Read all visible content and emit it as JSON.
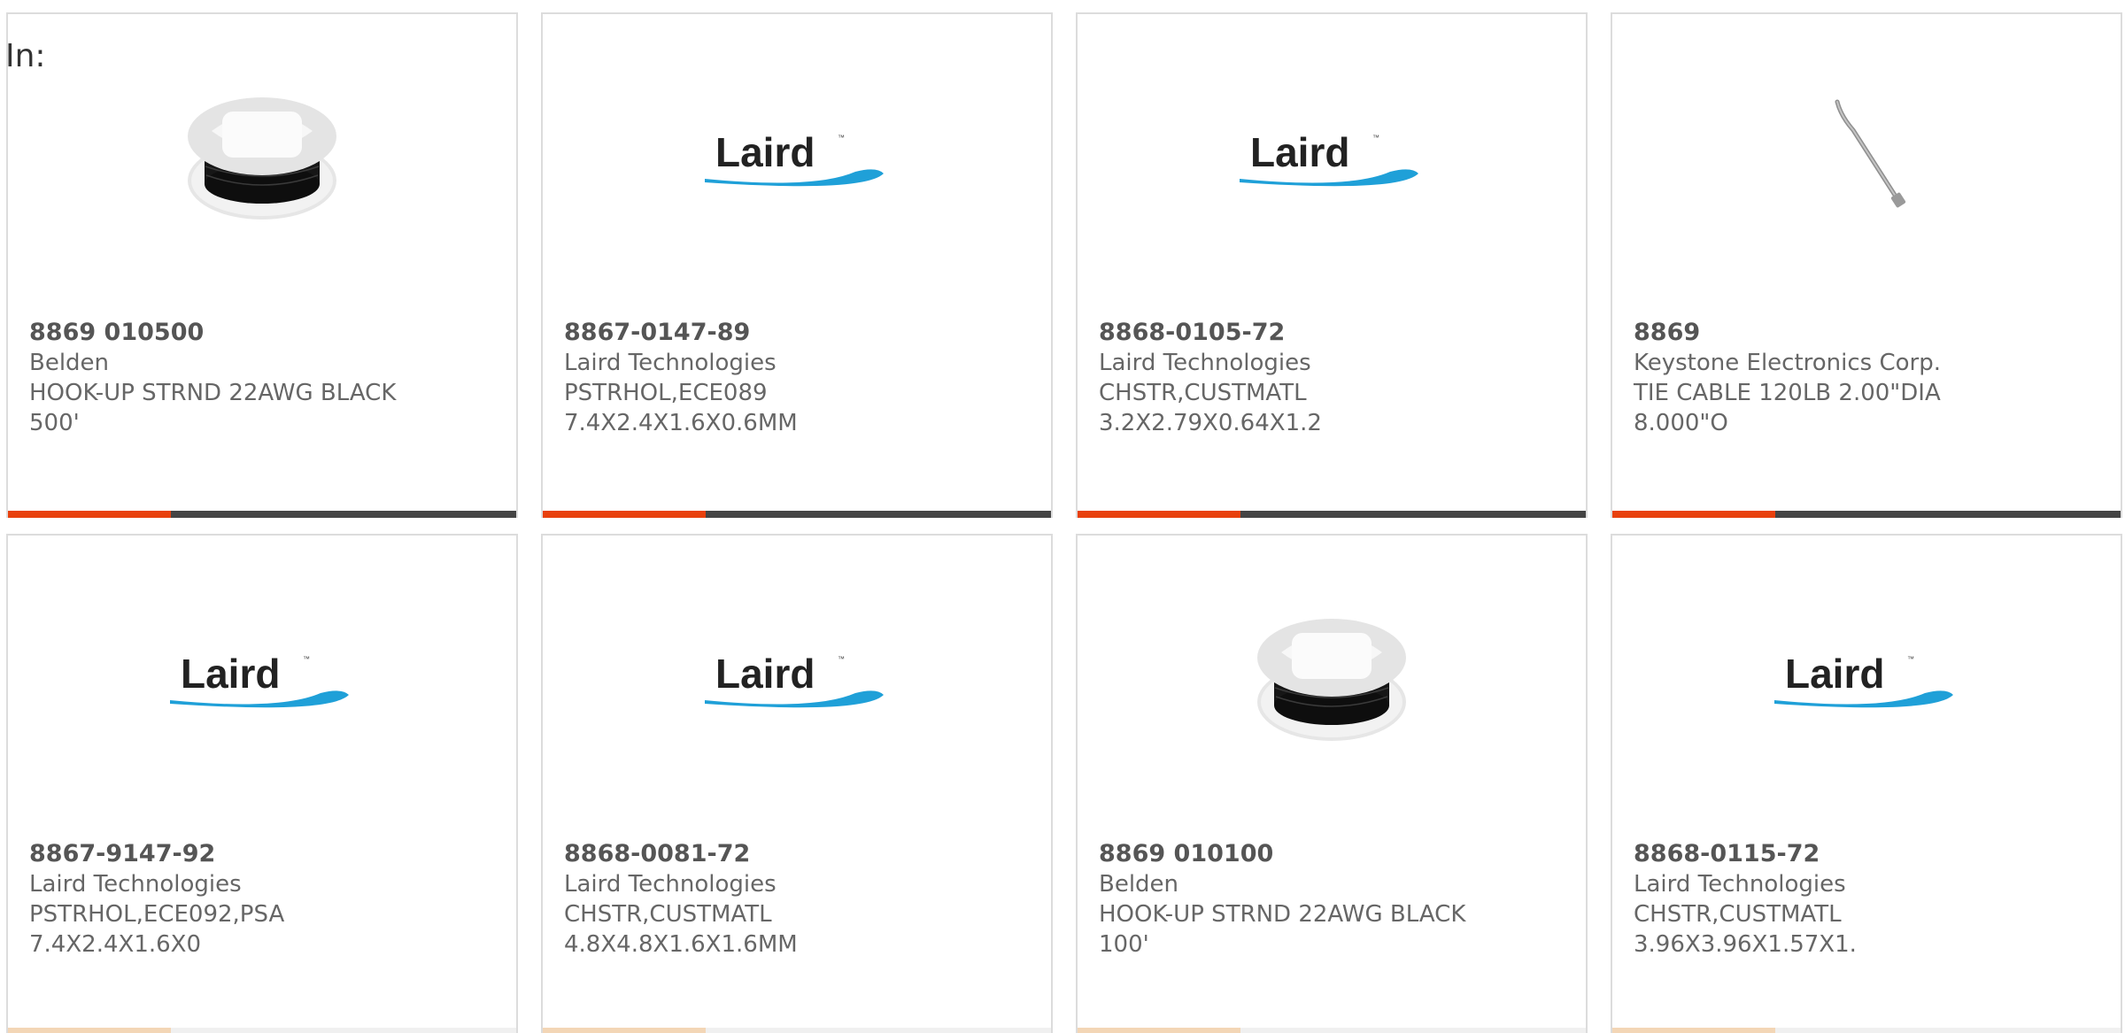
{
  "filter_label": "In:",
  "colors": {
    "accent": "#e8400c",
    "bar_track": "#444444",
    "laird_blue": "#1fa0d8",
    "text_gray": "#666666"
  },
  "cards": [
    {
      "part_number": "8869 010500",
      "manufacturer": "Belden",
      "description": "HOOK-UP STRND 22AWG BLACK\n500'",
      "image": "wire-spool-icon",
      "logo_text": "",
      "progress": 0.32
    },
    {
      "part_number": "8867-0147-89",
      "manufacturer": "Laird Technologies",
      "description": "PSTRHOL,ECE089\n7.4X2.4X1.6X0.6MM",
      "image": "laird-logo",
      "logo_text": "Laird",
      "progress": 0.32
    },
    {
      "part_number": "8868-0105-72",
      "manufacturer": "Laird Technologies",
      "description": "CHSTR,CUSTMATL\n3.2X2.79X0.64X1.2",
      "image": "laird-logo",
      "logo_text": "Laird",
      "progress": 0.32
    },
    {
      "part_number": "8869",
      "manufacturer": "Keystone Electronics Corp.",
      "description": "TIE CABLE 120LB 2.00\"DIA\n8.000\"O",
      "image": "cable-tie-icon",
      "logo_text": "",
      "progress": 0.32
    },
    {
      "part_number": "8867-9147-92",
      "manufacturer": "Laird Technologies",
      "description": "PSTRHOL,ECE092,PSA\n7.4X2.4X1.6X0",
      "image": "laird-logo",
      "logo_text": "Laird",
      "progress": 0.32
    },
    {
      "part_number": "8868-0081-72",
      "manufacturer": "Laird Technologies",
      "description": "CHSTR,CUSTMATL\n4.8X4.8X1.6X1.6MM",
      "image": "laird-logo",
      "logo_text": "Laird",
      "progress": 0.32
    },
    {
      "part_number": "8869 010100",
      "manufacturer": "Belden",
      "description": "HOOK-UP STRND 22AWG BLACK\n100'",
      "image": "wire-spool-icon",
      "logo_text": "",
      "progress": 0.32
    },
    {
      "part_number": "8868-0115-72",
      "manufacturer": "Laird Technologies",
      "description": "CHSTR,CUSTMATL\n3.96X3.96X1.57X1.",
      "image": "laird-logo",
      "logo_text": "Laird",
      "progress": 0.32
    }
  ]
}
